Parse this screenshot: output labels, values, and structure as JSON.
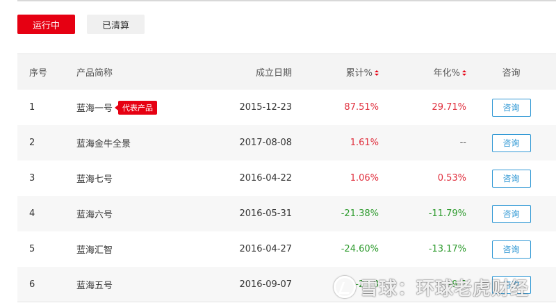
{
  "tabs": {
    "running": "运行中",
    "cleared": "已清算"
  },
  "table": {
    "headers": {
      "index": "序号",
      "name": "产品简称",
      "date": "成立日期",
      "cumulative": "累计%",
      "annualized": "年化%",
      "consult": "咨询"
    },
    "rows": [
      {
        "index": "1",
        "name": "蓝海一号",
        "badge": "代表产品",
        "date": "2015-12-23",
        "cumulative": "87.51%",
        "annualized": "29.71%",
        "action": "咨询"
      },
      {
        "index": "2",
        "name": "蓝海金牛全景",
        "date": "2017-08-08",
        "cumulative": "1.61%",
        "annualized": "--",
        "action": "咨询"
      },
      {
        "index": "3",
        "name": "蓝海七号",
        "date": "2016-04-22",
        "cumulative": "1.06%",
        "annualized": "0.53%",
        "action": "咨询"
      },
      {
        "index": "4",
        "name": "蓝海六号",
        "date": "2016-05-31",
        "cumulative": "-21.38%",
        "annualized": "-11.79%",
        "action": "咨询"
      },
      {
        "index": "5",
        "name": "蓝海汇智",
        "date": "2016-04-27",
        "cumulative": "-24.60%",
        "annualized": "-13.17%",
        "action": "咨询"
      },
      {
        "index": "6",
        "name": "蓝海五号",
        "date": "2016-09-07",
        "cumulative": "-21.8",
        "annualized": "-9.5",
        "action": "咨询"
      }
    ]
  },
  "watermark": "雪球：环球老虎财经",
  "colors": {
    "accent": "#e60012",
    "positive": "#e02f3d",
    "negative": "#2e9b2e",
    "button": "#2e97d4"
  }
}
